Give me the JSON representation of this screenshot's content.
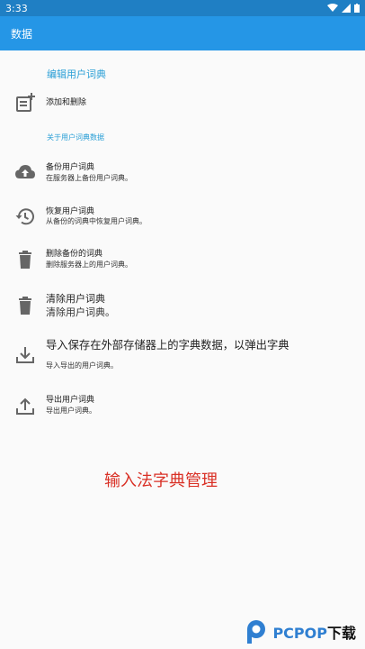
{
  "status_bar": {
    "time": "3:33"
  },
  "app_bar": {
    "title": "数据"
  },
  "sections": {
    "edit_header": "编辑用户词典",
    "about_header": "关于用户词典数据"
  },
  "items": {
    "add_delete": {
      "title": "添加和删除",
      "icon": "add-note-icon"
    },
    "backup": {
      "title": "备份用户词典",
      "summary": "在服务器上备份用户词典。",
      "icon": "cloud-upload-icon"
    },
    "restore": {
      "title": "恢复用户词典",
      "summary": "从备份的词典中恢复用户词典。",
      "icon": "history-icon"
    },
    "delete_backup": {
      "title": "删除备份的词典",
      "summary": "删除服务器上的用户词典。",
      "icon": "trash-icon"
    },
    "clear": {
      "title": "清除用户词典",
      "summary": "清除用户词典。",
      "icon": "trash-icon"
    },
    "import": {
      "title": "导入保存在外部存储器上的字典数据，以弹出字典",
      "summary": "导入导出的用户词典。",
      "icon": "download-icon"
    },
    "export": {
      "title": "导出用户词典",
      "summary": "导出用户词典。",
      "icon": "upload-icon"
    }
  },
  "caption": "输入法字典管理",
  "watermark": {
    "brand": "PCPOP",
    "suffix": "下载"
  },
  "colors": {
    "app_bar": "#2596e6",
    "status_bar": "#1f7fc4",
    "accent": "#2a9fd6",
    "caption": "#d93025"
  }
}
